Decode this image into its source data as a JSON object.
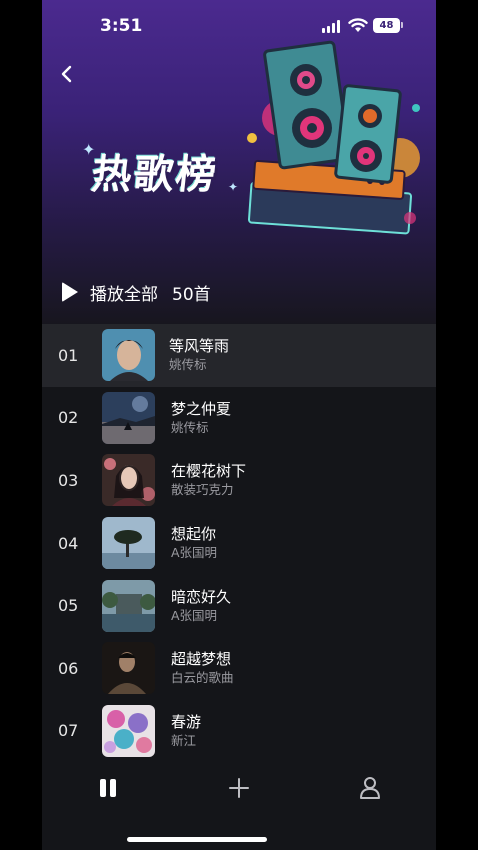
{
  "status_bar": {
    "time": "3:51",
    "battery": "48"
  },
  "header": {
    "title_art": "热歌榜"
  },
  "play_all": {
    "label": "播放全部",
    "count": "50首"
  },
  "songs": [
    {
      "index": "01",
      "title": "等风等雨",
      "artist": "姚传标"
    },
    {
      "index": "02",
      "title": "梦之仲夏",
      "artist": "姚传标"
    },
    {
      "index": "03",
      "title": "在樱花树下",
      "artist": "散装巧克力"
    },
    {
      "index": "04",
      "title": "想起你",
      "artist": "A张国明"
    },
    {
      "index": "05",
      "title": "暗恋好久",
      "artist": "A张国明"
    },
    {
      "index": "06",
      "title": "超越梦想",
      "artist": "白云的歌曲"
    },
    {
      "index": "07",
      "title": "春游",
      "artist": "新江"
    }
  ],
  "tab_bar": {
    "icons": [
      "pause-icon",
      "plus-icon",
      "user-icon"
    ]
  },
  "colors": {
    "header_top": "#4b2a8f",
    "background": "#141519",
    "active_row": "#25262b",
    "secondary_text": "#9a9aa0"
  }
}
